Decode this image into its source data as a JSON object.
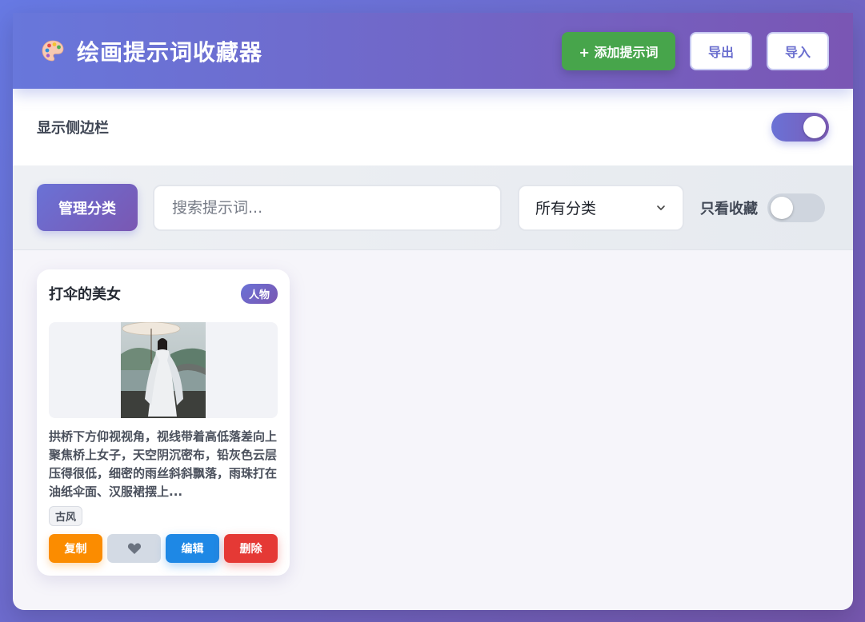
{
  "header": {
    "title": "绘画提示词收藏器",
    "logo_icon": "palette-icon",
    "add_label": "+ 添加提示词",
    "export_label": "导出",
    "import_label": "导入"
  },
  "sidebar_toggle": {
    "label": "显示侧边栏",
    "on": true
  },
  "filters": {
    "manage_label": "管理分类",
    "search_placeholder": "搜索提示词...",
    "search_value": "",
    "category_selected": "所有分类",
    "favorites_only_label": "只看收藏",
    "favorites_only_on": false
  },
  "cards": [
    {
      "title": "打伞的美女",
      "category": "人物",
      "description": "拱桥下方仰视视角，视线带着高低落差向上聚焦桥上女子，天空阴沉密布，铅灰色云层压得很低，细密的雨丝斜斜飘落，雨珠打在油纸伞面、汉服裙摆上...",
      "tags": [
        "古风"
      ],
      "copy_label": "复制",
      "fav_icon": "heart-icon",
      "edit_label": "编辑",
      "delete_label": "删除"
    }
  ],
  "colors": {
    "accent": "#6a72d6",
    "add_button": "#47a54b",
    "copy_button": "#fb8c00",
    "edit_button": "#1e88e5",
    "delete_button": "#e53935"
  }
}
